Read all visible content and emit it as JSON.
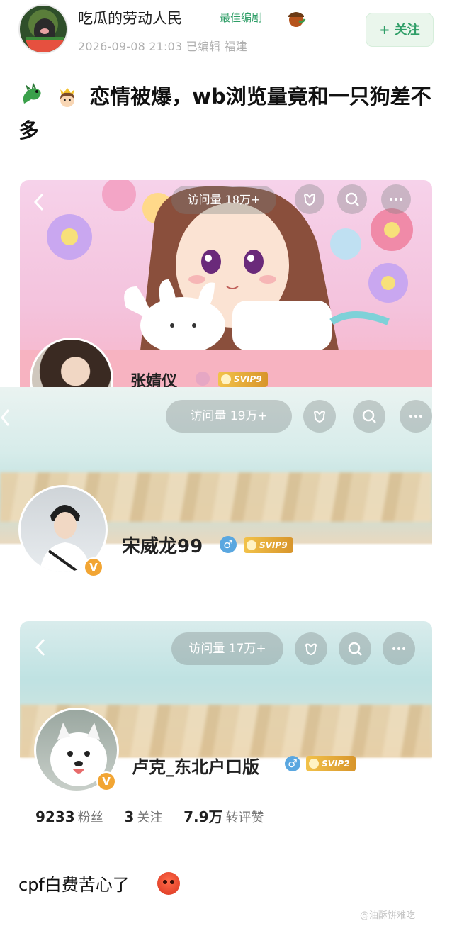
{
  "post": {
    "author_name": "吃瓜的劳动人民",
    "author_badge": "最佳编剧",
    "meta": "2026-09-08 21:03 已编辑 福建",
    "follow_label": "+ 关注",
    "title": "恋情被爆，wb浏览量竟和一只狗差不多",
    "comment": "cpf白费苦心了"
  },
  "profiles": [
    {
      "visits": "访问量 18万+",
      "name": "张婧仪",
      "vip": "SVIP9"
    },
    {
      "visits": "访问量 19万+",
      "name": "宋威龙99",
      "vip": "SVIP9",
      "gender_icon": "♂",
      "verified_mark": "V"
    },
    {
      "visits": "访问量 17万+",
      "name": "卢克_东北户口版",
      "vip": "SVIP2",
      "gender_icon": "♂",
      "verified_mark": "V",
      "stats": [
        {
          "value": "9233",
          "label": "粉丝"
        },
        {
          "value": "3",
          "label": "关注"
        },
        {
          "value": "7.9万",
          "label": "转评赞"
        }
      ]
    }
  ],
  "watermark": "@油酥饼难吃",
  "colors": {
    "accent_green": "#2f9e67",
    "verified_orange": "#f2a533",
    "gender_blue": "#5aa7e0"
  },
  "icons": [
    "back-arrow-icon",
    "gift-icon",
    "search-icon",
    "more-icon",
    "verified-v-icon",
    "male-icon",
    "svip-crown-icon"
  ]
}
